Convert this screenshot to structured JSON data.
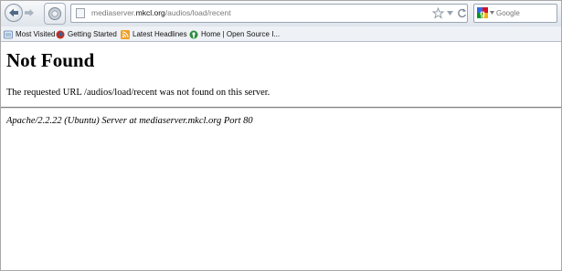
{
  "browser": {
    "url": {
      "host_prefix": "mediaserver.",
      "domain": "mkcl.org",
      "path": "/audios/load/recent"
    },
    "search": {
      "placeholder": "Google"
    }
  },
  "bookmarks": [
    {
      "label": "Most Visited",
      "icon": "most-visited-icon"
    },
    {
      "label": "Getting Started",
      "icon": "firefox-icon"
    },
    {
      "label": "Latest Headlines",
      "icon": "rss-feed-icon"
    },
    {
      "label": "Home | Open Source I...",
      "icon": "open-source-icon"
    }
  ],
  "page": {
    "title": "Not Found",
    "message": "The requested URL /audios/load/recent was not found on this server.",
    "signature": "Apache/2.2.22 (Ubuntu) Server at mediaserver.mkcl.org Port 80"
  }
}
